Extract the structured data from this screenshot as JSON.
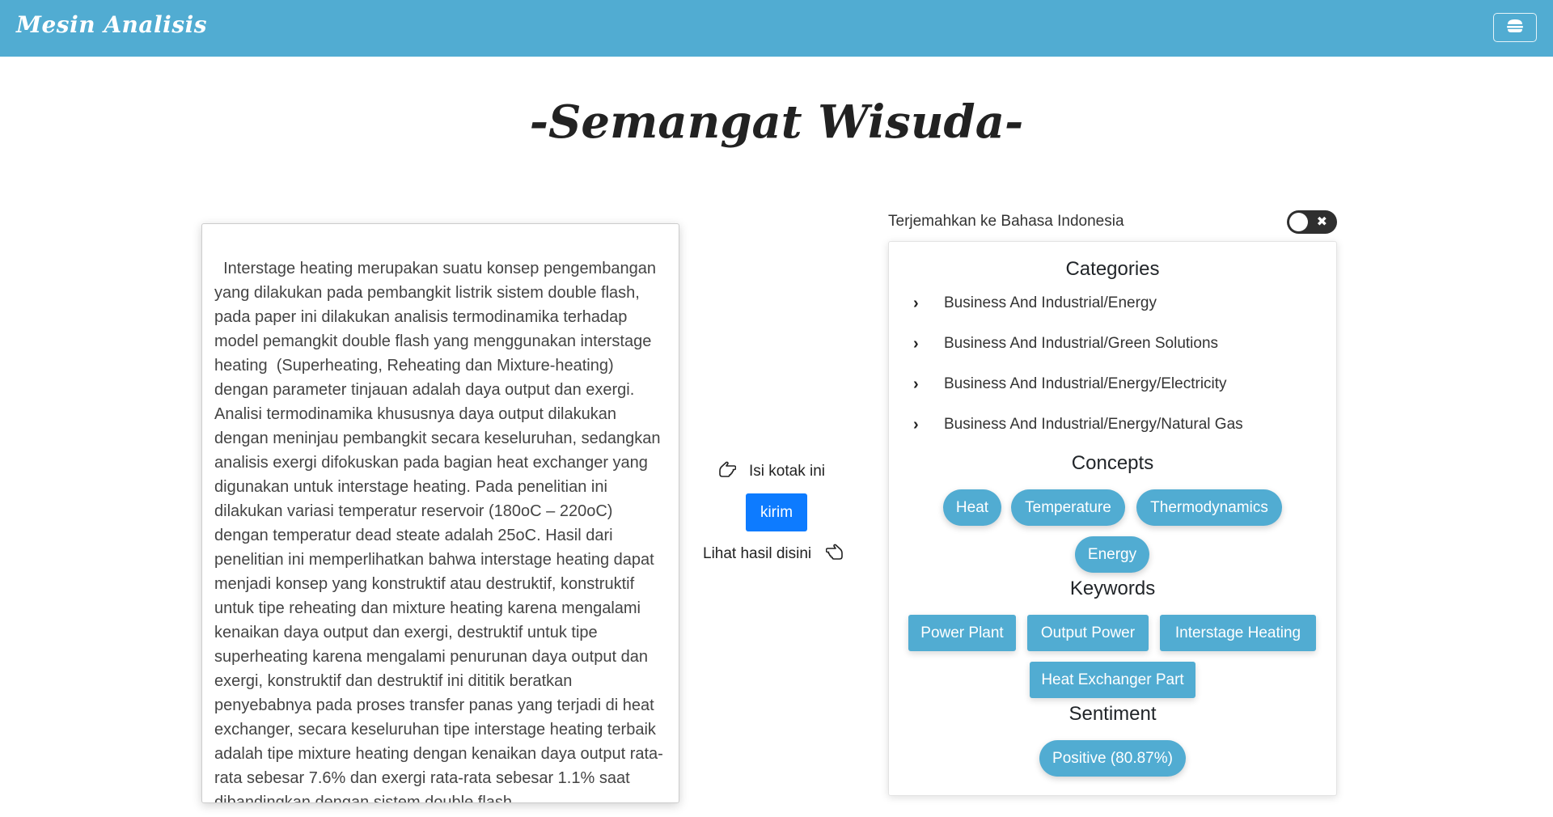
{
  "navbar": {
    "brand": "Mesin Analisis",
    "menu_icon": "hamburger-icon"
  },
  "page_title": "-Semangat Wisuda-",
  "input": {
    "text": "Interstage heating merupakan suatu konsep pengembangan yang dilakukan pada pembangkit listrik sistem double flash, pada paper ini dilakukan analisis termodinamika terhadap model pemangkit double flash yang menggunakan interstage heating  (Superheating, Reheating dan Mixture-heating) dengan parameter tinjauan adalah daya output dan exergi. Analisi termodinamika khususnya daya output dilakukan dengan meninjau pembangkit secara keseluruhan, sedangkan analisis exergi difokuskan pada bagian heat exchanger yang digunakan untuk interstage heating. Pada penelitian ini dilakukan variasi temperatur reservoir (180oC – 220oC) dengan temperatur dead steate adalah 25oC. Hasil dari penelitian ini memperlihatkan bahwa interstage heating dapat menjadi konsep yang konstruktif atau destruktif, konstruktif untuk tipe reheating dan mixture heating karena mengalami kenaikan daya output dan exergi, destruktif untuk tipe superheating karena mengalami penurunan daya output dan exergi, konstruktif dan destruktif ini dititik beratkan penyebabnya pada proses transfer panas yang terjadi di heat exchanger, secara keseluruhan tipe interstage heating terbaik adalah tipe mixture heating dengan kenaikan daya output rata-rata sebesar 7.6% dan exergi rata-rata sebesar 1.1% saat dibandingkan dengan sistem double flash."
  },
  "middle": {
    "fill_hint": "Isi kotak ini",
    "send_label": "kirim",
    "result_hint": "Lihat hasil disini",
    "fill_icon": "hand-point-left-icon",
    "result_icon": "hand-point-right-icon"
  },
  "translate": {
    "label": "Terjemahkan ke Bahasa Indonesia",
    "toggle_icon": "close-icon",
    "enabled": false
  },
  "results": {
    "categories_title": "Categories",
    "categories": [
      "Business And Industrial/Energy",
      "Business And Industrial/Green Solutions",
      "Business And Industrial/Energy/Electricity",
      "Business And Industrial/Energy/Natural Gas"
    ],
    "concepts_title": "Concepts",
    "concepts": [
      "Heat",
      "Temperature",
      "Thermodynamics",
      "Energy"
    ],
    "keywords_title": "Keywords",
    "keywords": [
      "Power Plant",
      "Output Power",
      "Interstage Heating",
      "Heat Exchanger Part"
    ],
    "sentiment_title": "Sentiment",
    "sentiment": "Positive (80.87%)"
  },
  "colors": {
    "navbar": "#51acd2",
    "send_button": "#0d7bff",
    "pill": "#51acd2"
  }
}
